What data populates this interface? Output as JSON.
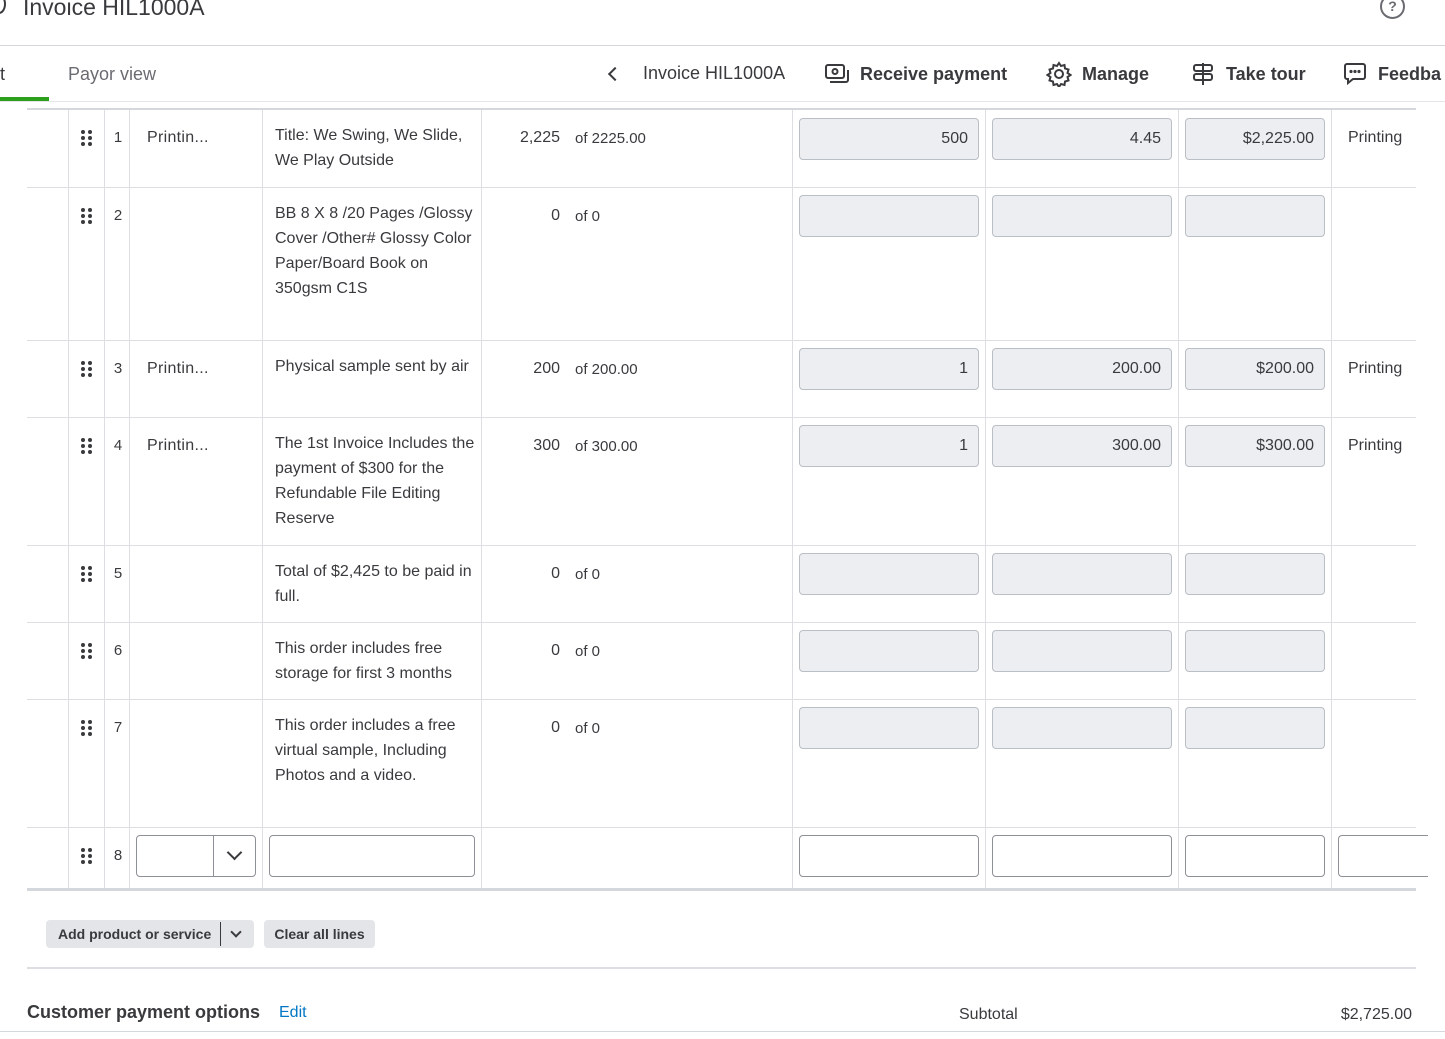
{
  "header": {
    "title": "Invoice HIL1000A",
    "help_glyph": "?"
  },
  "tabs": {
    "partial_label": "t",
    "payor_view": "Payor view"
  },
  "toolbar": {
    "invoice_label": "Invoice HIL1000A",
    "receive_payment": "Receive payment",
    "manage": "Manage",
    "take_tour": "Take tour",
    "feedback": "Feedba"
  },
  "lines": [
    {
      "num": "1",
      "product": "Printin...",
      "description": "Title: We Swing, We Slide, We Play Outside",
      "qty": "2,225",
      "qty_of": "of 2225.00",
      "field1": "500",
      "field2": "4.45",
      "amount": "$2,225.00",
      "class": "Printing"
    },
    {
      "num": "2",
      "product": "",
      "description": "BB 8 X 8 /20 Pages /Glossy Cover /Other# Glossy Color Paper/Board Book on 350gsm C1S",
      "qty": "0",
      "qty_of": "of 0",
      "field1": "",
      "field2": "",
      "amount": "",
      "class": ""
    },
    {
      "num": "3",
      "product": "Printin...",
      "description": "Physical sample sent by air",
      "qty": "200",
      "qty_of": "of 200.00",
      "field1": "1",
      "field2": "200.00",
      "amount": "$200.00",
      "class": "Printing"
    },
    {
      "num": "4",
      "product": "Printin...",
      "description": "The 1st Invoice Includes the payment of $300 for the Refundable File Editing Reserve",
      "qty": "300",
      "qty_of": "of 300.00",
      "field1": "1",
      "field2": "300.00",
      "amount": "$300.00",
      "class": "Printing"
    },
    {
      "num": "5",
      "product": "",
      "description": "Total of $2,425 to be paid in full.",
      "qty": "0",
      "qty_of": "of 0",
      "field1": "",
      "field2": "",
      "amount": "",
      "class": ""
    },
    {
      "num": "6",
      "product": "",
      "description": "This order includes free storage for first 3 months",
      "qty": "0",
      "qty_of": "of 0",
      "field1": "",
      "field2": "",
      "amount": "",
      "class": ""
    },
    {
      "num": "7",
      "product": "",
      "description": "This order includes a free virtual sample, Including Photos and a video.",
      "qty": "0",
      "qty_of": "of 0",
      "field1": "",
      "field2": "",
      "amount": "",
      "class": ""
    },
    {
      "num": "8"
    }
  ],
  "actions": {
    "add_product": "Add product or service",
    "clear_lines": "Clear all lines"
  },
  "footer": {
    "payment_options": "Customer payment options",
    "edit": "Edit",
    "subtotal_label": "Subtotal",
    "subtotal_value": "$2,725.00"
  },
  "colors": {
    "accent_green": "#2ca01c",
    "link_blue": "#0077c5",
    "text_dark": "#393a3d",
    "field_bg": "#eceef1"
  }
}
